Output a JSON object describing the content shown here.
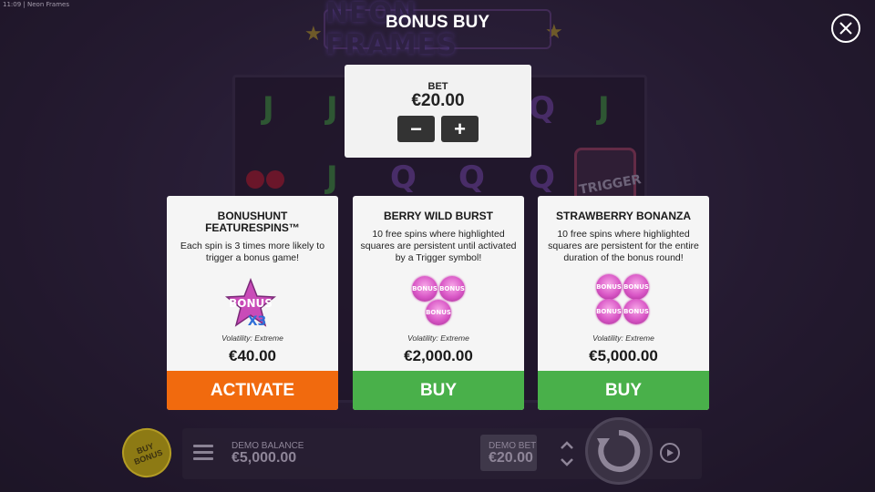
{
  "status_bar": {
    "time": "11:09",
    "app": "Neon Frames"
  },
  "game": {
    "logo": "NEON FRAMES",
    "trigger_tile_label": "TRIGGER"
  },
  "modal": {
    "title": "BONUS BUY",
    "bet": {
      "label": "BET",
      "value": "€20.00",
      "minus_label": "−",
      "plus_label": "+"
    },
    "cards": [
      {
        "title": "BONUSHUNT FEATURESPINS™",
        "description": "Each spin is 3 times more likely to trigger a bonus game!",
        "icon_text_top": "BONUS",
        "icon_text_bottom": "X3",
        "volatility": "Volatility: Extreme",
        "price": "€40.00",
        "button_label": "ACTIVATE",
        "button_color": "#f16a0e"
      },
      {
        "title": "BERRY WILD BURST",
        "description": "10 free spins where highlighted squares are persistent until activated by a Trigger symbol!",
        "icon_badge_text": "BONUS",
        "volatility": "Volatility: Extreme",
        "price": "€2,000.00",
        "button_label": "BUY",
        "button_color": "#49b04a"
      },
      {
        "title": "STRAWBERRY BONANZA",
        "description": "10 free spins where highlighted squares are persistent for the entire duration of the bonus round!",
        "icon_badge_text": "BONUS",
        "volatility": "Volatility: Extreme",
        "price": "€5,000.00",
        "button_label": "BUY",
        "button_color": "#49b04a"
      }
    ]
  },
  "bottom_bar": {
    "buy_bonus_label": "BUY BONUS",
    "balance_label": "DEMO BALANCE",
    "balance_value": "€5,000.00",
    "bet_label": "DEMO BET",
    "bet_value": "€20.00"
  },
  "icons": [
    "close-icon",
    "menu-icon",
    "chevron-up-icon",
    "chevron-down-icon",
    "spin-icon",
    "autoplay-icon",
    "star-icon"
  ]
}
